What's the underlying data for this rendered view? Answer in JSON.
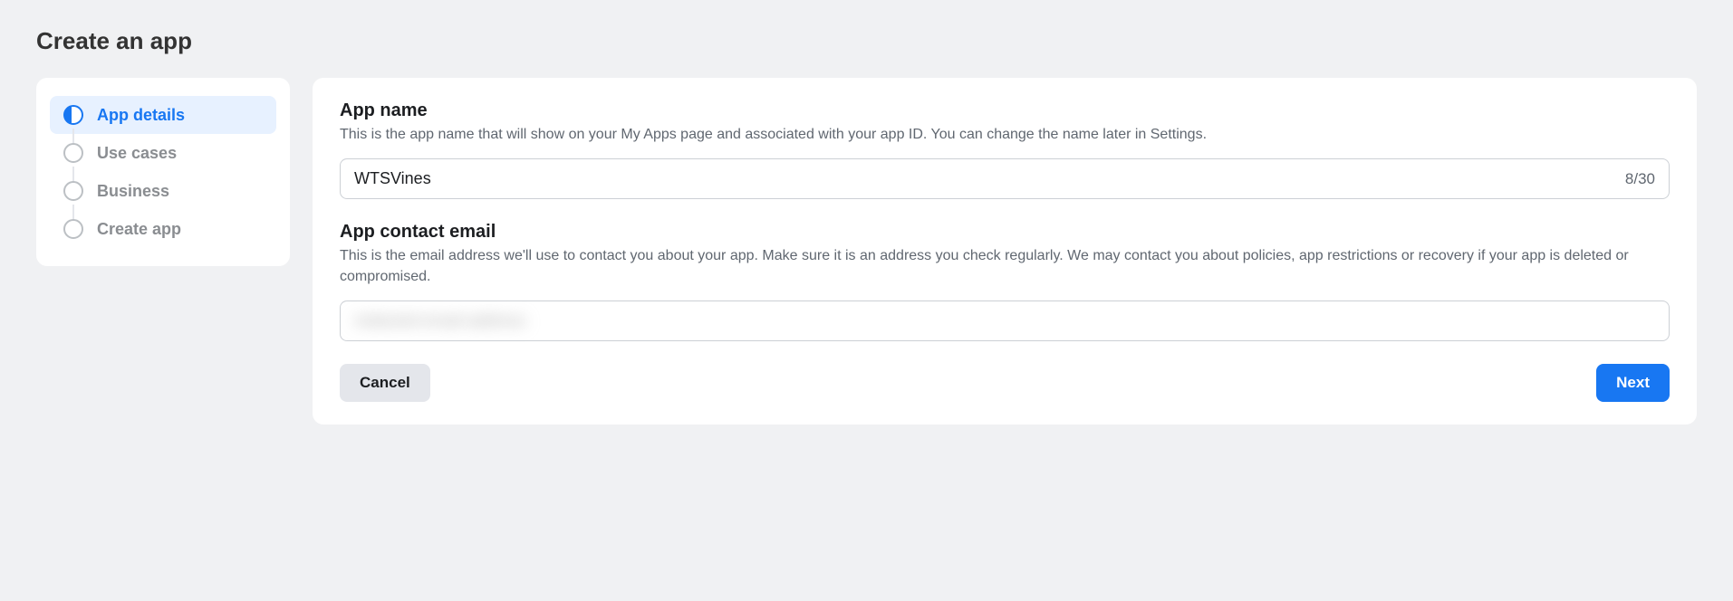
{
  "page": {
    "title": "Create an app"
  },
  "sidebar": {
    "steps": [
      {
        "label": "App details",
        "active": true
      },
      {
        "label": "Use cases",
        "active": false
      },
      {
        "label": "Business",
        "active": false
      },
      {
        "label": "Create app",
        "active": false
      }
    ]
  },
  "form": {
    "app_name": {
      "label": "App name",
      "desc": "This is the app name that will show on your My Apps page and associated with your app ID. You can change the name later in Settings.",
      "value": "WTSVines",
      "counter": "8/30"
    },
    "email": {
      "label": "App contact email",
      "desc": "This is the email address we'll use to contact you about your app. Make sure it is an address you check regularly. We may contact you about policies, app restrictions or recovery if your app is deleted or compromised.",
      "value": "redacted-email-address"
    }
  },
  "buttons": {
    "cancel": "Cancel",
    "next": "Next"
  }
}
